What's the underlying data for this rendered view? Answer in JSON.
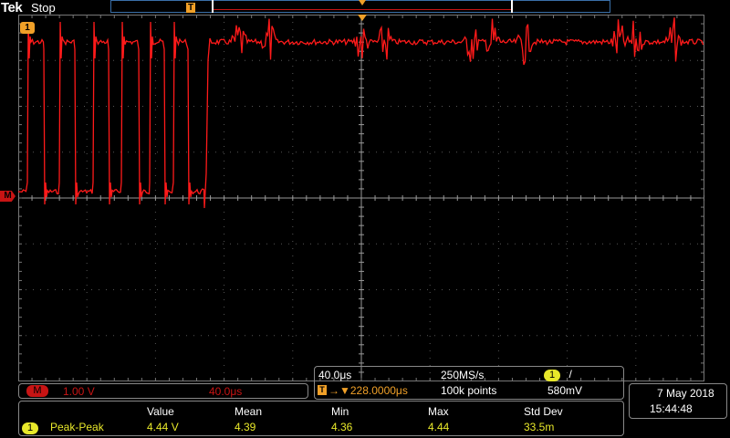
{
  "header": {
    "brand": "Tek",
    "status": "Stop",
    "trigger_marker": "T"
  },
  "channel": {
    "tag": "1",
    "math_tag": "M"
  },
  "math_box": {
    "label": "M",
    "scale": "1.00 V",
    "time": "40.0μs"
  },
  "horizontal": {
    "time_per_div": "40.0μs",
    "sample_rate": "250MS/s",
    "trigger_label": "T",
    "trigger_delay": "→▼228.0000μs",
    "record_length": "100k points",
    "trigger_source": "1",
    "trigger_slope": "/",
    "trigger_level": "580mV"
  },
  "datetime": {
    "date": "7 May 2018",
    "time": "15:44:48"
  },
  "stats": {
    "headers": [
      "Value",
      "Mean",
      "Min",
      "Max",
      "Std Dev"
    ],
    "source": "1",
    "name": "Peak-Peak",
    "values": [
      "4.44 V",
      "4.39",
      "4.36",
      "4.44",
      "33.5m"
    ]
  },
  "colors": {
    "trace": "#ff1a1a",
    "trigger": "#f0a028",
    "math": "#c81414",
    "channel1": "#e8e82a"
  }
}
